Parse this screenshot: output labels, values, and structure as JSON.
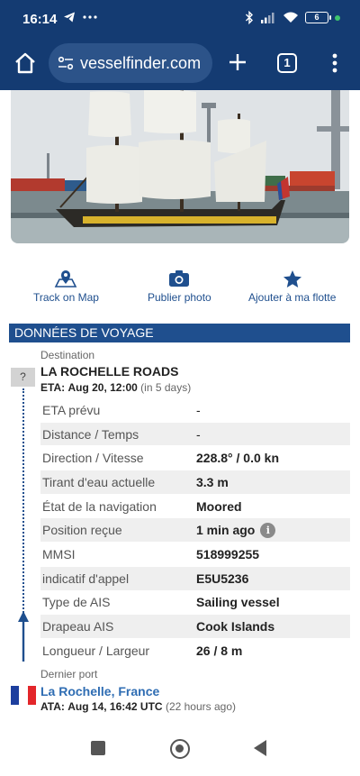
{
  "status_bar": {
    "time": "16:14",
    "battery": "6",
    "left_icons": [
      "telegram-icon",
      "more-dots-icon"
    ],
    "right_icons": [
      "bluetooth-icon",
      "signal-icon",
      "wifi-icon",
      "battery-icon"
    ]
  },
  "browser": {
    "url": "vesselfinder.com",
    "tab_count": "1"
  },
  "actions": [
    {
      "label": "Track on Map",
      "icon": "map-pin-icon"
    },
    {
      "label": "Publier photo",
      "icon": "camera-icon"
    },
    {
      "label": "Ajouter à ma flotte",
      "icon": "star-icon"
    }
  ],
  "voyage": {
    "section_title": "DONNÉES DE VOYAGE",
    "destination_label": "Destination",
    "destination": "LA ROCHELLE ROADS",
    "destination_badge": "?",
    "eta_label": "ETA:",
    "eta_value": "Aug 20, 12:00",
    "eta_relative": "(in 5 days)",
    "rows": [
      {
        "key": "ETA prévu",
        "value": "-"
      },
      {
        "key": "Distance / Temps",
        "value": "-"
      },
      {
        "key": "Direction / Vitesse",
        "value": "228.8° / 0.0 kn"
      },
      {
        "key": "Tirant d'eau actuelle",
        "value": "3.3 m"
      },
      {
        "key": "État de la navigation",
        "value": "Moored"
      },
      {
        "key": "Position reçue",
        "value": "1 min ago"
      },
      {
        "key": "MMSI",
        "value": "518999255"
      },
      {
        "key": "indicatif d'appel",
        "value": "E5U5236"
      },
      {
        "key": "Type de AIS",
        "value": "Sailing vessel"
      },
      {
        "key": "Drapeau AIS",
        "value": "Cook Islands"
      },
      {
        "key": "Longueur / Largeur",
        "value": "26 / 8 m"
      }
    ],
    "info_icon": "i",
    "last_port_label": "Dernier port",
    "last_port": "La Rochelle, France",
    "ata_label": "ATA:",
    "ata_value": "Aug 14, 16:42 UTC",
    "ata_relative": "(22 hours ago)",
    "flag_colors": [
      "#1d3f9e",
      "#ffffff",
      "#e3262a"
    ]
  },
  "colors": {
    "brand": "#143b72",
    "accent": "#1f4f8e",
    "link": "#2f6db3"
  }
}
